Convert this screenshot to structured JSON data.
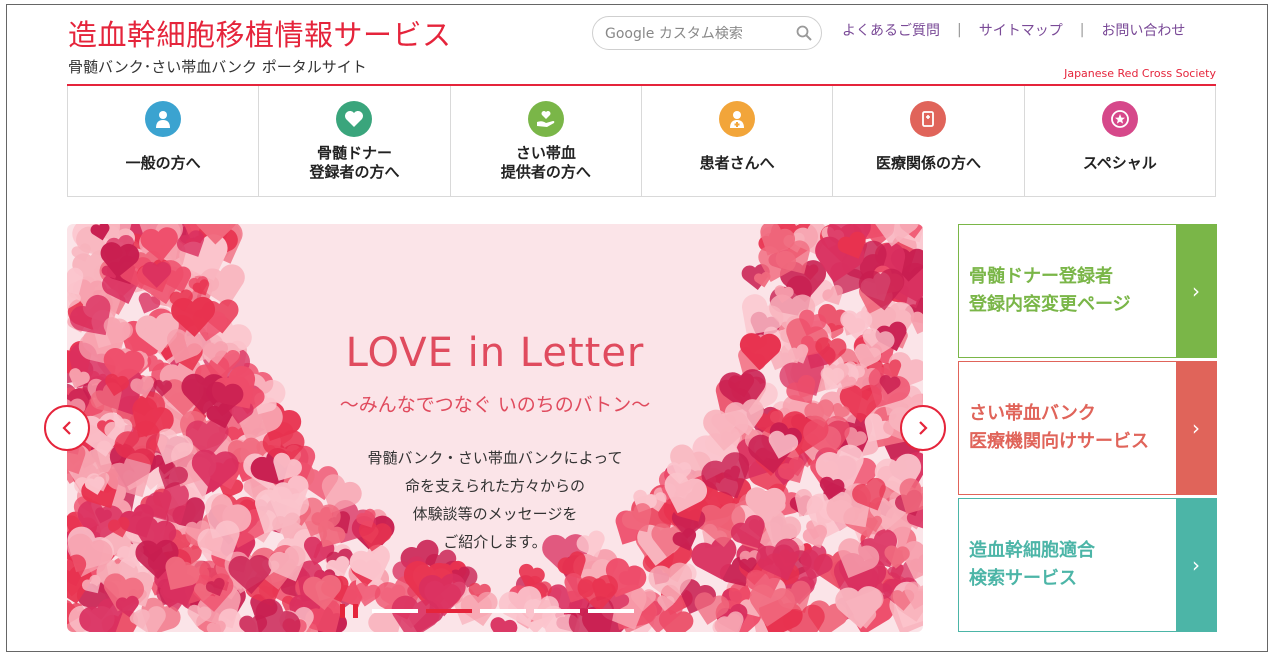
{
  "header": {
    "title": "造血幹細胞移植情報サービス",
    "subtitle": "骨髄バンク･さい帯血バンク ポータルサイト",
    "org": "Japanese Red Cross Society",
    "search_placeholder": "Google カスタム検索",
    "links": [
      {
        "label": "よくあるご質問"
      },
      {
        "label": "サイトマップ"
      },
      {
        "label": "お問い合わせ"
      }
    ],
    "accent_color": "#e5243b"
  },
  "nav": {
    "items": [
      {
        "label": "一般の方へ",
        "icon": "person-icon",
        "color": "#3ba3d0"
      },
      {
        "label": "骨髄ドナー\n登録者の方へ",
        "icon": "heart-icon",
        "color": "#3aa57c"
      },
      {
        "label": "さい帯血\n提供者の方へ",
        "icon": "hand-heart-icon",
        "color": "#7ab648"
      },
      {
        "label": "患者さんへ",
        "icon": "patient-icon",
        "color": "#f2a53a"
      },
      {
        "label": "医療関係の方へ",
        "icon": "medical-icon",
        "color": "#e0645a"
      },
      {
        "label": "スペシャル",
        "icon": "star-icon",
        "color": "#d6488a"
      }
    ]
  },
  "slider": {
    "heading": "LOVE in Letter",
    "subheading": "〜みんなでつなぐ いのちのバトン〜",
    "body_lines": [
      "骨髄バンク・さい帯血バンクによって",
      "命を支えられた方々からの",
      "体験談等のメッセージを",
      "ご紹介します。"
    ],
    "slide_count": 5,
    "active_slide": 2
  },
  "banners": [
    {
      "line1": "骨髄ドナー登録者",
      "line2": "登録内容変更ページ",
      "color": "#7ab648"
    },
    {
      "line1": "さい帯血バンク",
      "line2": "医療機関向けサービス",
      "color": "#e0645a"
    },
    {
      "line1": "造血幹細胞適合",
      "line2": "検索サービス",
      "color": "#4cb5a7"
    }
  ]
}
